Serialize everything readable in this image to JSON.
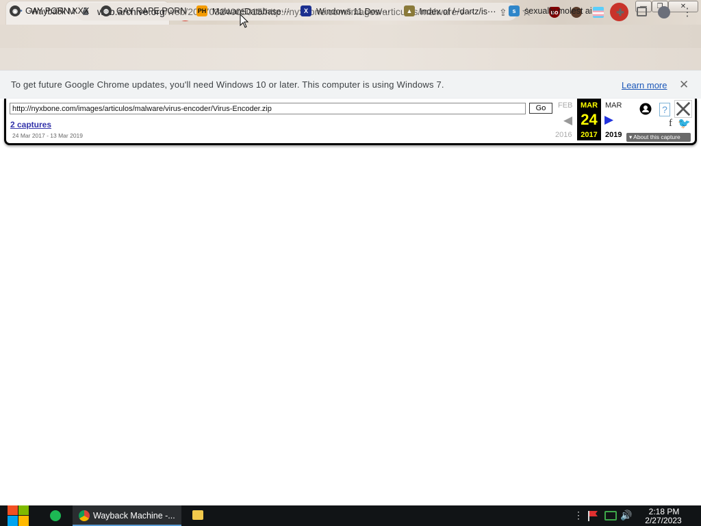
{
  "browser": {
    "tab": {
      "title": "Wayback Machine",
      "close_glyph": "✕"
    },
    "newtab_glyph": "+",
    "tabsearch_glyph": "⌄",
    "window": {
      "minimize": "—",
      "maximize": "❐",
      "close": "✕"
    },
    "nav": {
      "back": "←",
      "forward": "→",
      "reload": "✕"
    },
    "address": {
      "host": "web.archive.org",
      "rest": "/web/20170324005015/http://nyxbone.com/images/articulos/malware/v⋯"
    },
    "icons": {
      "share": "⇪",
      "star": "☆",
      "menu": "⋮",
      "puzzle": "✚"
    }
  },
  "bookmarks": [
    {
      "label": "GAY PORN XXX",
      "icon": "generic-site-icon"
    },
    {
      "label": "GAY RAPE PORN",
      "icon": "globe-icon"
    },
    {
      "label": "MalwareDatabase⋯",
      "icon": "ph-icon",
      "icon_text": "PH"
    },
    {
      "label": "Windows 11 Dow⋯",
      "icon": "x-icon",
      "icon_text": "X"
    },
    {
      "label": "Index of /~dartz/is⋯",
      "icon": "folder-icon"
    },
    {
      "label": "sexually molest ai",
      "icon": "site-icon"
    }
  ],
  "infobar": {
    "message": "To get future Google Chrome updates, you'll need Windows 10 or later. This computer is using Windows 7.",
    "learn_more": "Learn more",
    "close_glyph": "✕"
  },
  "wayback": {
    "url_value": "http://nyxbone.com/images/articulos/malware/virus-encoder/Virus-Encoder.zip",
    "go_label": "Go",
    "captures_label": "2 captures",
    "range_label": "24 Mar 2017 - 13 Mar 2019",
    "prev": {
      "month": "FEB",
      "year": "2016",
      "arrow": "◀"
    },
    "current": {
      "month": "MAR",
      "day": "24",
      "year": "2017"
    },
    "next": {
      "month": "MAR",
      "year": "2019",
      "arrow": "▶"
    },
    "help_glyph": "?",
    "facebook_glyph": "f",
    "twitter_glyph": "🐦",
    "about_label": "▾ About this capture"
  },
  "taskbar": {
    "chrome_label": "Wayback Machine -...",
    "tray_more": "⋮",
    "volume_glyph": "🔊",
    "time": "2:18 PM",
    "date": "2/27/2023"
  },
  "colors": {
    "wayback_highlight": "#ffff00",
    "wayback_next_arrow": "#2233dd",
    "taskbar_bg": "#111416",
    "newtab_red": "#d33a2c",
    "link_blue": "#1a56b8"
  }
}
